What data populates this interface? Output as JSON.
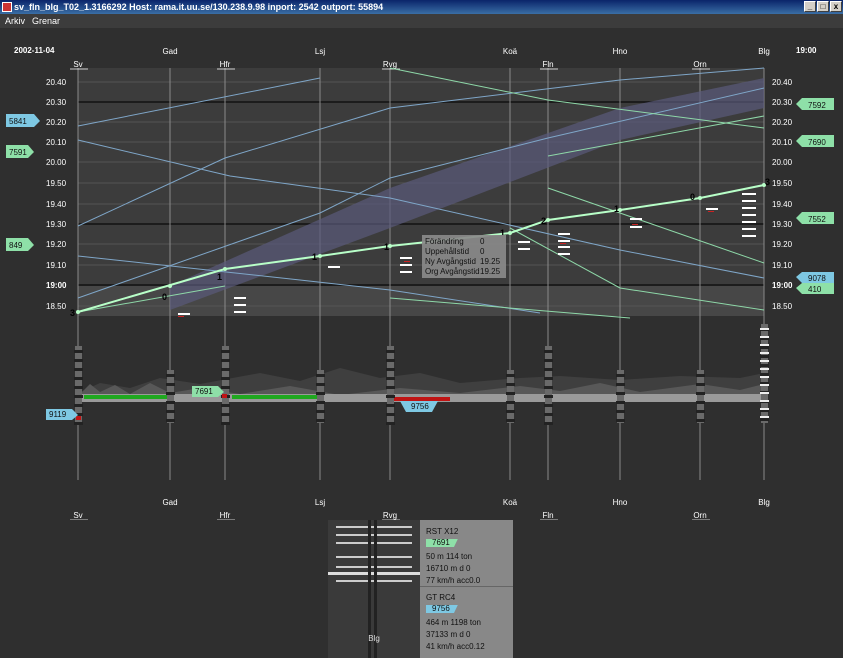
{
  "window": {
    "title": "sv_fln_blg_T02_1.3166292  Host: rama.it.uu.se/130.238.9.98 inport: 2542 outport: 55894",
    "buttons": [
      "_",
      "□",
      "x"
    ]
  },
  "menu": [
    "Arkiv",
    "Grenar"
  ],
  "header": {
    "date": "2002-11-04",
    "time": "19:00"
  },
  "stations": [
    "Sv",
    "Gad",
    "Hfr",
    "Lsj",
    "Rvg",
    "Koä",
    "Fln",
    "Hno",
    "Orn",
    "Blg"
  ],
  "time_ticks": [
    "20.40",
    "20.30",
    "20.20",
    "20.10",
    "20.00",
    "19.50",
    "19.40",
    "19.30",
    "19.20",
    "19.10",
    "19:00",
    "18.50"
  ],
  "left_train_tags": [
    {
      "text": "5841",
      "color": "#7ec8e3"
    },
    {
      "text": "7591",
      "color": "#8ee0a8"
    },
    {
      "text": "849",
      "color": "#8ee0a8"
    }
  ],
  "right_train_tags": [
    {
      "text": "7592",
      "color": "#8ee0a8"
    },
    {
      "text": "7690",
      "color": "#8ee0a8"
    },
    {
      "text": "7552",
      "color": "#8ee0a8"
    },
    {
      "text": "9078",
      "color": "#7ec8e3"
    },
    {
      "text": "410",
      "color": "#8ee0a8"
    }
  ],
  "tooltip": {
    "rows": [
      {
        "label": "Förändring",
        "value": "0"
      },
      {
        "label": "Uppehållstid",
        "value": "0"
      },
      {
        "label": "Ny Avgångstid",
        "value": "19.25"
      },
      {
        "label": "Org Avgångstid",
        "value": "19.25"
      }
    ]
  },
  "route_numbers": [
    "3",
    "0",
    "1",
    "1",
    "1",
    "1",
    "2",
    "1",
    "0",
    "3"
  ],
  "track_tags": [
    {
      "text": "7691",
      "color": "#8ee0a8"
    },
    {
      "text": "9119",
      "color": "#7ec8e3"
    },
    {
      "text": "9756",
      "color": "#7ec8e3"
    }
  ],
  "info_panel": {
    "station": "Blg",
    "trains": [
      {
        "type": "RST X12",
        "id": "7691",
        "id_color": "#8ee0a8",
        "length_weight": "50 m  114 ton",
        "distance": "16710 m d 0",
        "speed": "77 km/h acc0.0"
      },
      {
        "type": "GT  RC4",
        "id": "9756",
        "id_color": "#7ec8e3",
        "length_weight": "464 m  1198 ton",
        "distance": "37133 m d 0",
        "speed": "41 km/h acc0.12"
      }
    ]
  }
}
